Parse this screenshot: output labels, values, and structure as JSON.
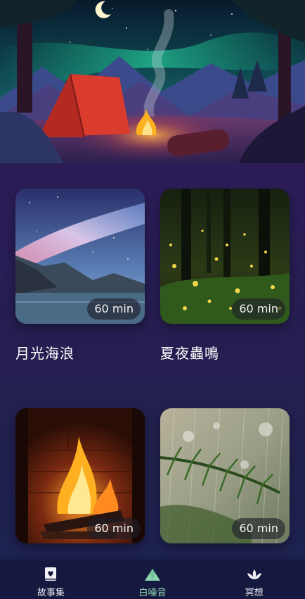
{
  "cards": [
    {
      "title": "月光海浪",
      "duration": "60 min"
    },
    {
      "title": "夏夜蟲鳴",
      "duration": "60 min"
    },
    {
      "title": "",
      "duration": "60 min"
    },
    {
      "title": "",
      "duration": "60 min"
    }
  ],
  "nav": {
    "items": [
      {
        "label": "故事集",
        "icon": "book-heart-icon",
        "active": false
      },
      {
        "label": "白噪音",
        "icon": "mountain-icon",
        "active": true
      },
      {
        "label": "冥想",
        "icon": "lotus-icon",
        "active": false
      }
    ],
    "active_color": "#8fd6b0"
  }
}
